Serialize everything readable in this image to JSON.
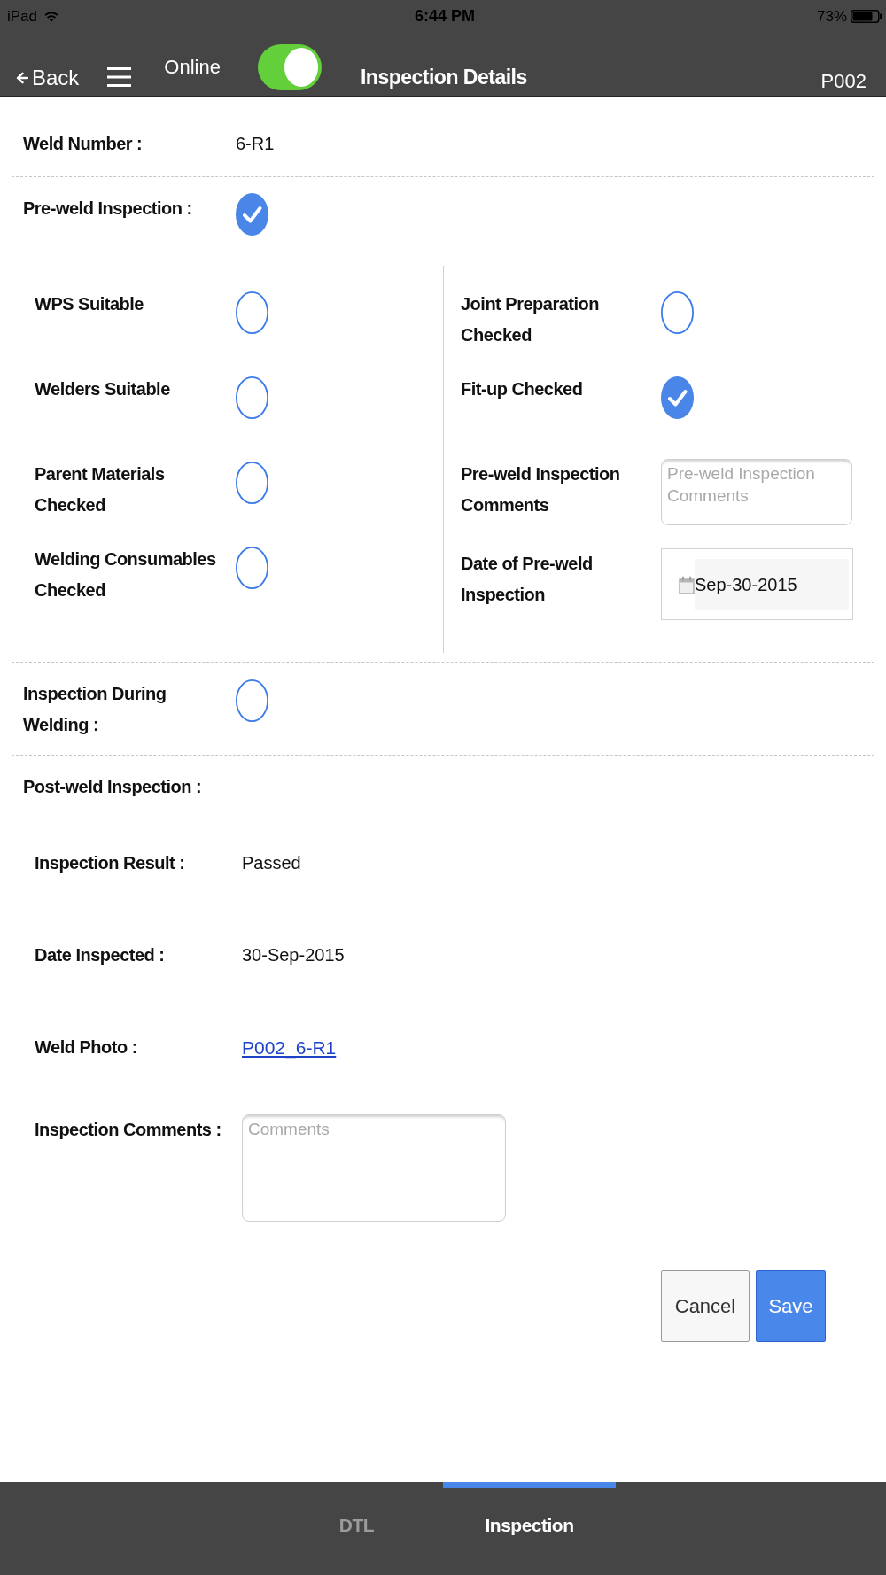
{
  "status_bar": {
    "carrier": "iPad",
    "time": "6:44 PM",
    "battery": "73%"
  },
  "nav_bar": {
    "back": "Back",
    "connection": {
      "label": "Online",
      "on": true
    },
    "title": "Inspection Details",
    "code": "P002"
  },
  "weld_number": {
    "label": "Weld Number :",
    "value": "6-R1"
  },
  "pre_weld": {
    "label": "Pre-weld Inspection :",
    "checked": true,
    "left_items": [
      {
        "label": "WPS Suitable",
        "checked": false
      },
      {
        "label": "Welders Suitable",
        "checked": false
      },
      {
        "label": "Parent Materials Checked",
        "checked": false
      },
      {
        "label": "Welding Consumables Checked",
        "checked": false
      }
    ],
    "right_items": [
      {
        "kind": "checkbox",
        "label": "Joint Preparation Checked",
        "checked": false
      },
      {
        "kind": "checkbox",
        "label": "Fit-up Checked",
        "checked": true
      },
      {
        "kind": "textarea",
        "label": "Pre-weld Inspection Comments",
        "placeholder": "Pre-weld Inspection Comments"
      },
      {
        "kind": "date",
        "label": "Date of Pre-weld Inspection",
        "value": "Sep-30-2015"
      }
    ]
  },
  "during_welding": {
    "label": "Inspection During Welding :",
    "checked": false
  },
  "post_weld": {
    "label": "Post-weld Inspection :",
    "fields": [
      {
        "kind": "text",
        "label": "Inspection Result :",
        "value": "Passed"
      },
      {
        "kind": "text",
        "label": "Date Inspected :",
        "value": "30-Sep-2015"
      },
      {
        "kind": "link",
        "label": "Weld Photo :",
        "value": "P002_6-R1"
      },
      {
        "kind": "textarea",
        "label": "Inspection Comments :",
        "placeholder": "Comments"
      }
    ]
  },
  "buttons": [
    {
      "kind": "secondary",
      "label": "Cancel"
    },
    {
      "kind": "primary",
      "label": "Save"
    }
  ],
  "tabs": [
    {
      "label": "DTL",
      "selected": false
    },
    {
      "label": "Inspection",
      "selected": true
    }
  ]
}
